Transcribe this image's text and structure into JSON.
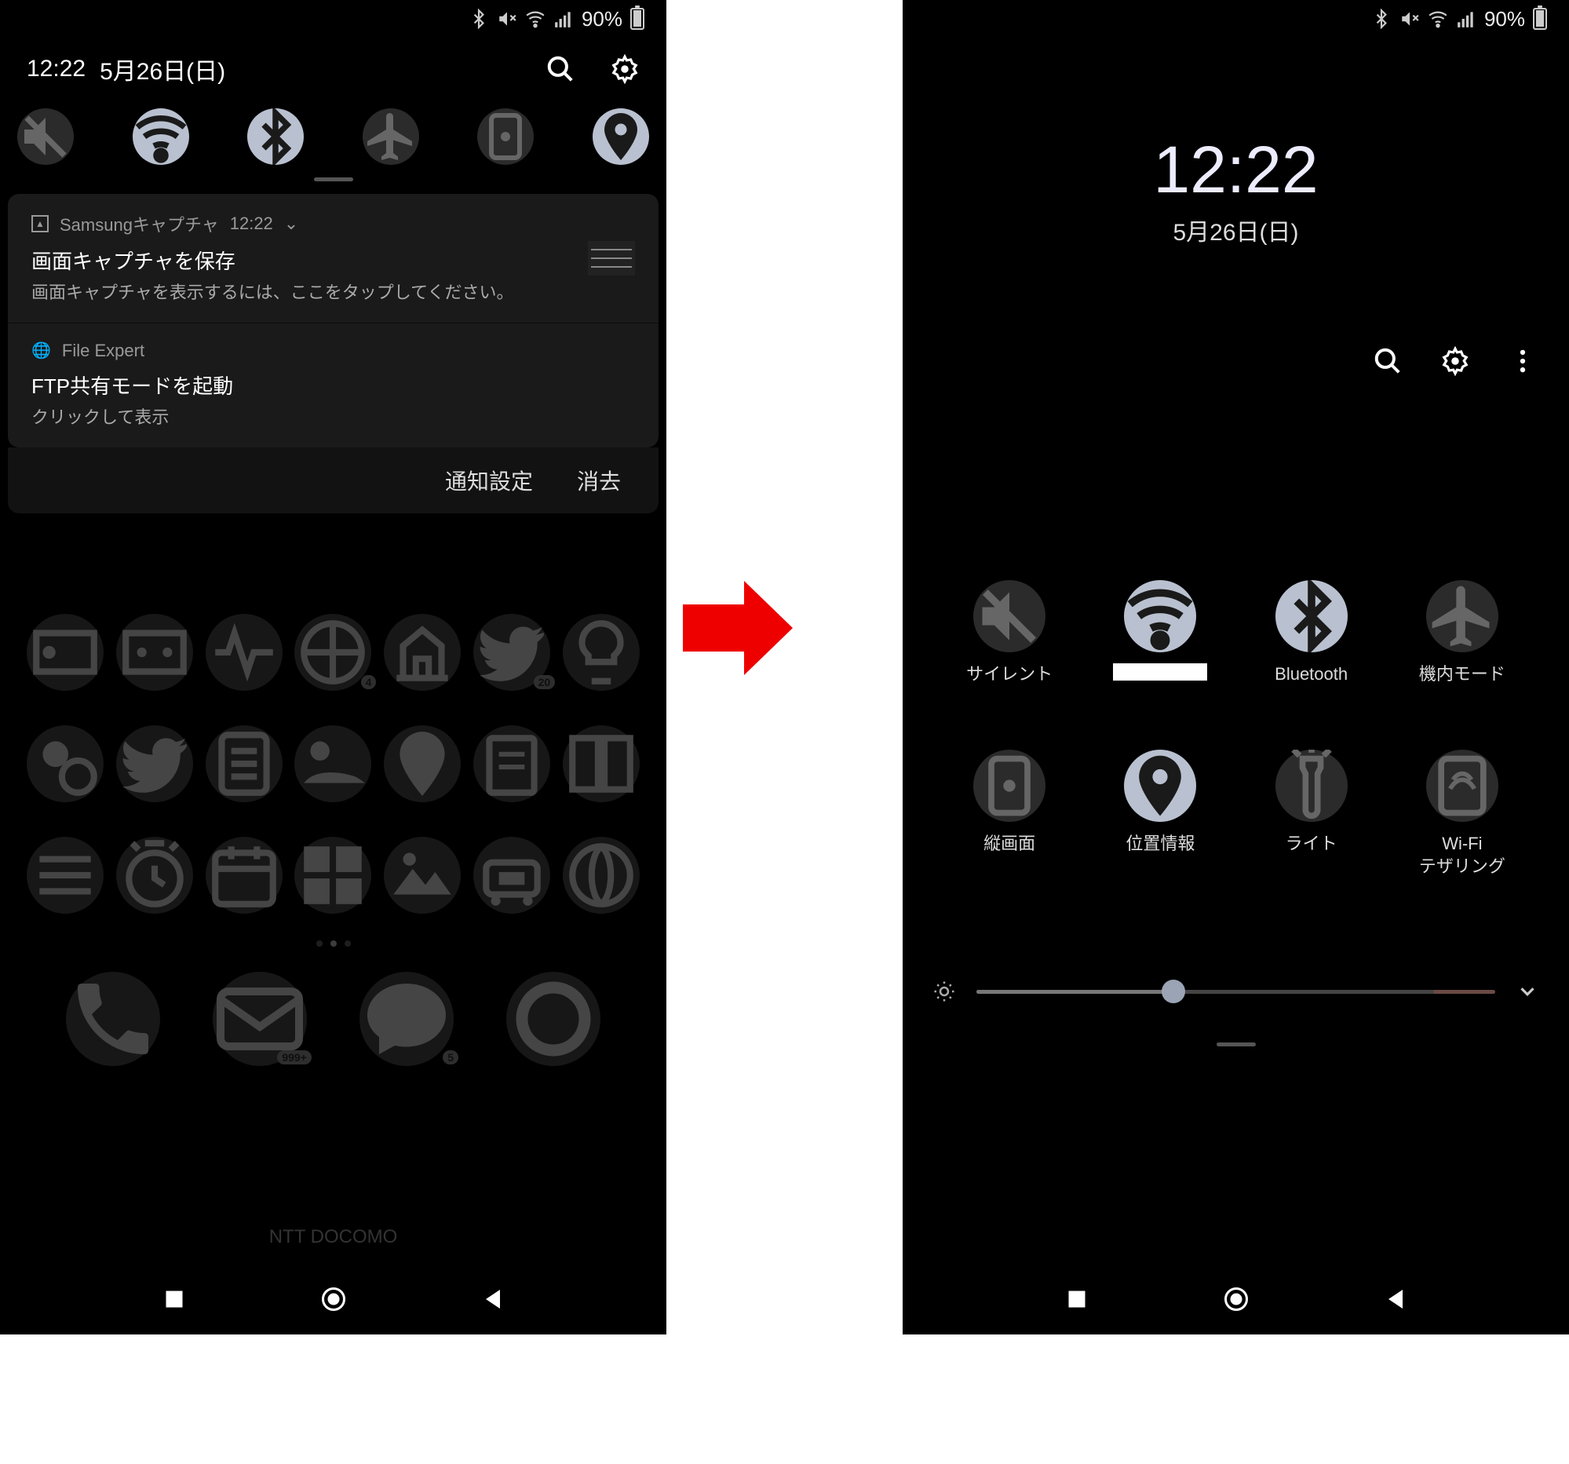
{
  "status": {
    "battery": "90%"
  },
  "left": {
    "time": "12:22",
    "date": "5月26日(日)",
    "toggles": [
      {
        "name": "silent",
        "on": false,
        "icon": "mute"
      },
      {
        "name": "wifi",
        "on": true,
        "icon": "wifi"
      },
      {
        "name": "bluetooth",
        "on": true,
        "icon": "bt"
      },
      {
        "name": "airplane",
        "on": false,
        "icon": "plane"
      },
      {
        "name": "rotation",
        "on": false,
        "icon": "lock"
      },
      {
        "name": "location",
        "on": true,
        "icon": "pin"
      }
    ],
    "notif1": {
      "app": "Samsungキャプチャ",
      "time": "12:22",
      "title": "画面キャプチャを保存",
      "body": "画面キャプチャを表示するには、ここをタップしてください。"
    },
    "notif2": {
      "app": "File Expert",
      "title": "FTP共有モードを起動",
      "body": "クリックして表示"
    },
    "actions": {
      "settings": "通知設定",
      "clear": "消去"
    },
    "carrier": "NTT DOCOMO",
    "badge999": "999+",
    "badge5": "5",
    "badge4": "4",
    "badge20": "20"
  },
  "right": {
    "time": "12:22",
    "date": "5月26日(日)",
    "tiles": [
      {
        "label": "サイレント",
        "on": false,
        "icon": "mute"
      },
      {
        "label": "",
        "redacted": true,
        "on": true,
        "icon": "wifi"
      },
      {
        "label": "Bluetooth",
        "on": true,
        "icon": "bt"
      },
      {
        "label": "機内モード",
        "on": false,
        "icon": "plane"
      },
      {
        "label": "縦画面",
        "on": false,
        "icon": "lock"
      },
      {
        "label": "位置情報",
        "on": true,
        "icon": "pin"
      },
      {
        "label": "ライト",
        "on": false,
        "icon": "torch"
      },
      {
        "label": "Wi-Fi\nテザリング",
        "on": false,
        "icon": "teth"
      }
    ],
    "brightness": 38
  }
}
